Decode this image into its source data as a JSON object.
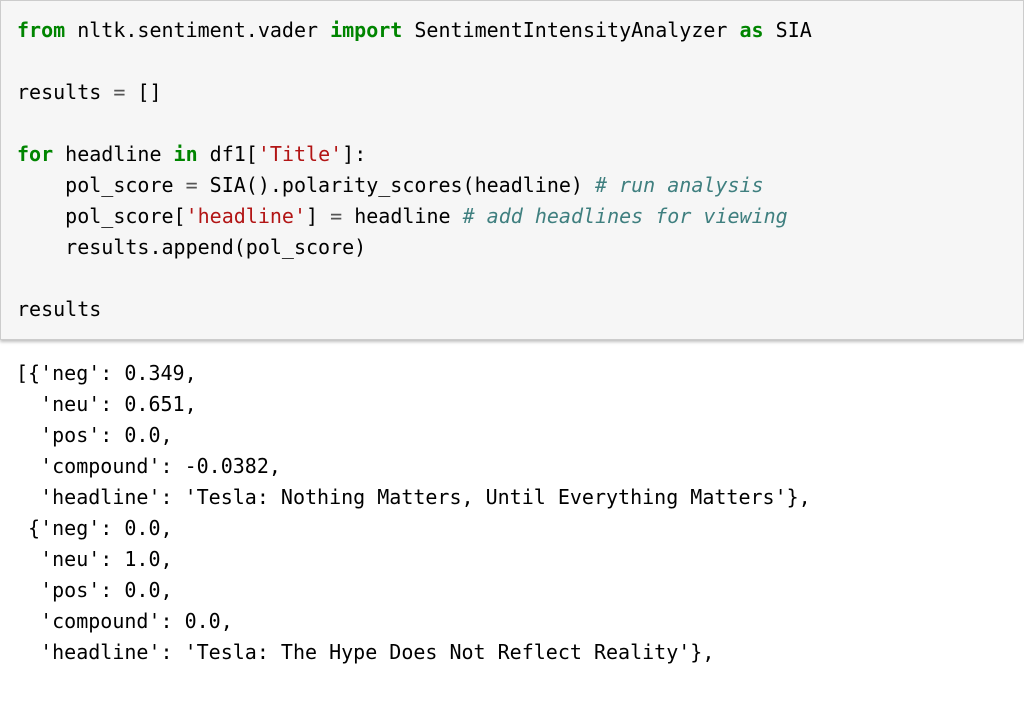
{
  "code": {
    "kw_from": "from",
    "module": "nltk.sentiment.vader",
    "kw_import": "import",
    "cls": "SentimentIntensityAnalyzer",
    "kw_as": "as",
    "alias": "SIA",
    "results_line_left": "results ",
    "eq": "=",
    "results_line_right": " []",
    "kw_for": "for",
    "for_mid": " headline ",
    "kw_in": "in",
    "for_tail_a": " df1[",
    "title_str": "'Title'",
    "for_tail_b": "]:",
    "indent": "    ",
    "l4_a": "pol_score ",
    "l4_b": " SIA().polarity_scores(headline) ",
    "cm1": "# run analysis",
    "l5_a": "pol_score[",
    "headline_str": "'headline'",
    "l5_b": "] ",
    "l5_c": " headline ",
    "cm2": "# add headlines for viewing",
    "l6": "results.append(pol_score)",
    "final": "results"
  },
  "output": {
    "l1": "[{'neg': 0.349,",
    "l2": "  'neu': 0.651,",
    "l3": "  'pos': 0.0,",
    "l4": "  'compound': -0.0382,",
    "l5": "  'headline': 'Tesla: Nothing Matters, Until Everything Matters'},",
    "l6": " {'neg': 0.0,",
    "l7": "  'neu': 1.0,",
    "l8": "  'pos': 0.0,",
    "l9": "  'compound': 0.0,",
    "l10": "  'headline': 'Tesla: The Hype Does Not Reflect Reality'},"
  }
}
